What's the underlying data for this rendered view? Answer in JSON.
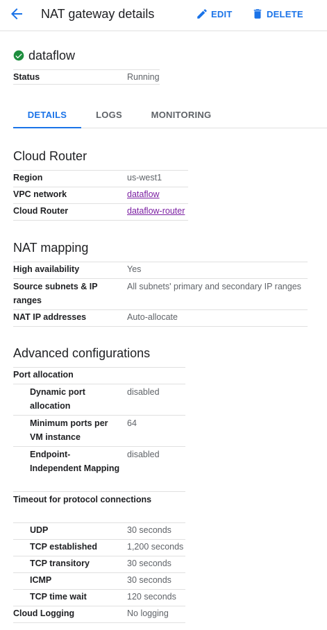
{
  "header": {
    "title": "NAT gateway details",
    "edit_label": "EDIT",
    "delete_label": "DELETE"
  },
  "resource": {
    "name": "dataflow",
    "status_label": "Status",
    "status_value": "Running"
  },
  "tabs": [
    {
      "label": "DETAILS",
      "active": true
    },
    {
      "label": "LOGS",
      "active": false
    },
    {
      "label": "MONITORING",
      "active": false
    }
  ],
  "cloud_router": {
    "title": "Cloud Router",
    "rows": [
      {
        "key": "Region",
        "value": "us-west1"
      },
      {
        "key": "VPC network",
        "value": "dataflow"
      },
      {
        "key": "Cloud Router",
        "value": "dataflow-router"
      }
    ]
  },
  "nat_mapping": {
    "title": "NAT mapping",
    "rows": [
      {
        "key": "High availability",
        "value": "Yes"
      },
      {
        "key": "Source subnets & IP ranges",
        "value": "All subnets' primary and secondary IP ranges"
      },
      {
        "key": "NAT IP addresses",
        "value": "Auto-allocate"
      }
    ]
  },
  "advanced": {
    "title": "Advanced configurations",
    "port_allocation": "Port allocation",
    "dynamic_port_key": "Dynamic port allocation",
    "dynamic_port_value": "disabled",
    "min_ports_key": "Minimum ports per VM instance",
    "min_ports_value": "64",
    "eim_key": "Endpoint-Independent Mapping",
    "eim_value": "disabled",
    "timeout_label": "Timeout for protocol connections",
    "timeouts": [
      {
        "key": "UDP",
        "value": "30 seconds"
      },
      {
        "key": "TCP established",
        "value": "1,200 seconds"
      },
      {
        "key": "TCP transitory",
        "value": "30 seconds"
      },
      {
        "key": "ICMP",
        "value": "30 seconds"
      },
      {
        "key": "TCP time wait",
        "value": "120 seconds"
      }
    ],
    "logging_key": "Cloud Logging",
    "logging_value": "No logging"
  },
  "colors": {
    "accent": "#1a73e8",
    "link": "#7b1fa2",
    "status_ok": "#1e8e3e"
  }
}
